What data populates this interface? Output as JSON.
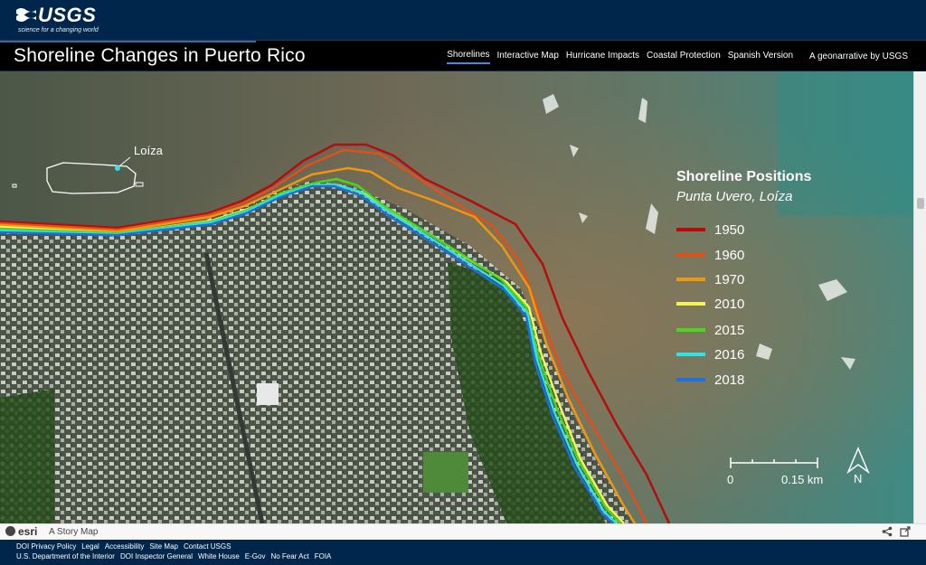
{
  "header": {
    "logo_text": "USGS",
    "logo_tagline": "science for a changing world"
  },
  "story": {
    "title": "Shoreline Changes in Puerto Rico",
    "nav": [
      {
        "label": "Shorelines",
        "active": true
      },
      {
        "label": "Interactive Map",
        "active": false
      },
      {
        "label": "Hurricane Impacts",
        "active": false
      },
      {
        "label": "Coastal Protection",
        "active": false
      },
      {
        "label": "Spanish Version",
        "active": false
      }
    ],
    "credit": "A geonarrative by USGS"
  },
  "map": {
    "inset_label": "Loíza",
    "legend": {
      "title": "Shoreline Positions",
      "subtitle": "Punta Uvero, Loíza",
      "items": [
        {
          "label": "1950",
          "color": "#b40d0d"
        },
        {
          "label": "1960",
          "color": "#e2501a"
        },
        {
          "label": "1970",
          "color": "#f0960f"
        },
        {
          "label": "2010",
          "color": "#f5f25a"
        },
        {
          "label": "2015",
          "color": "#49d61c"
        },
        {
          "label": "2016",
          "color": "#2ee3e6"
        },
        {
          "label": "2018",
          "color": "#1f6fe0"
        }
      ]
    },
    "scale": {
      "start": "0",
      "end": "0.15 km"
    },
    "north": "N"
  },
  "esri_bar": {
    "logo": "esri",
    "text": "A Story Map"
  },
  "footer": {
    "row1": [
      "DOI Privacy Policy",
      "Legal",
      "Accessibility",
      "Site Map",
      "Contact USGS"
    ],
    "row2": [
      "U.S. Department of the Interior",
      "DOI Inspector General",
      "White House",
      "E-Gov",
      "No Fear Act",
      "FOIA"
    ]
  }
}
